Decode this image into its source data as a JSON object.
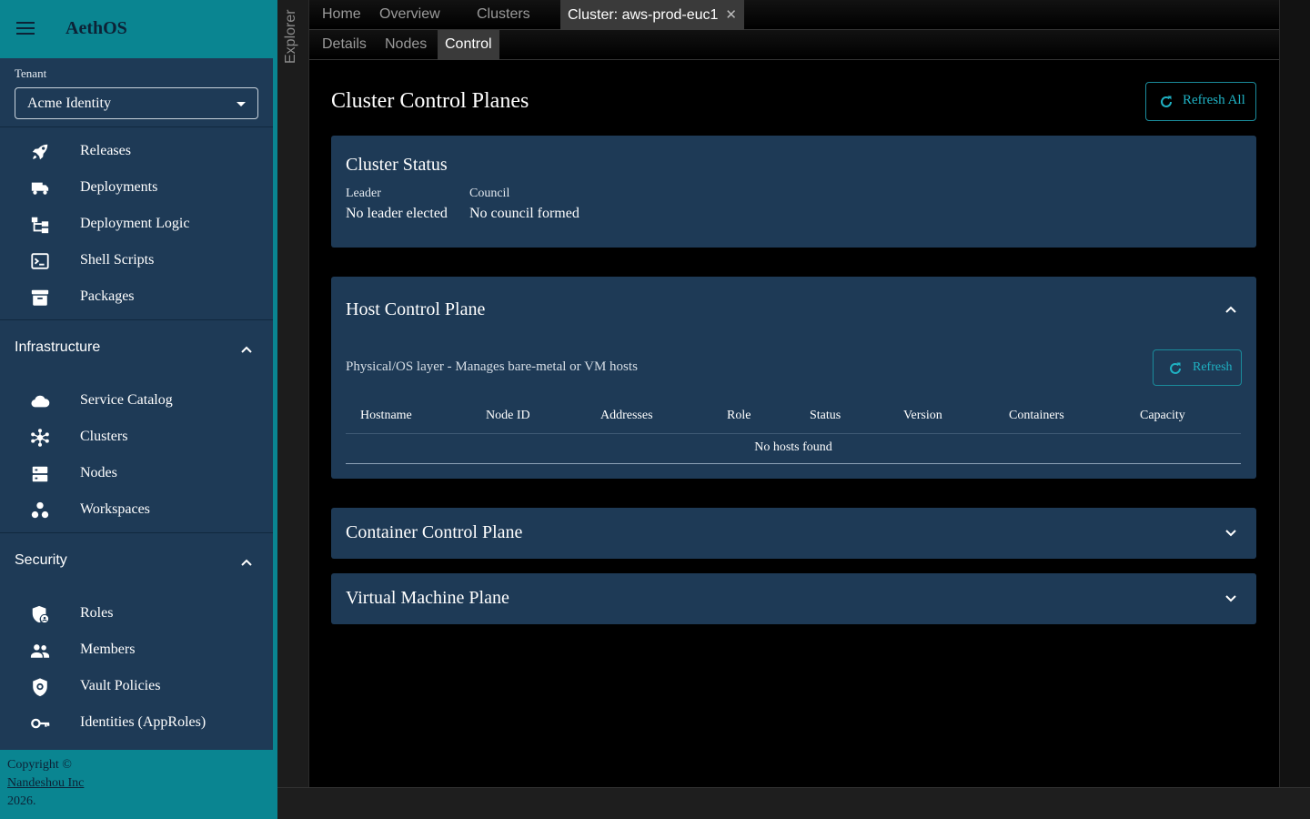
{
  "app": {
    "title": "AethOS"
  },
  "tenant": {
    "label": "Tenant",
    "value": "Acme Identity"
  },
  "nav": {
    "top_items": [
      {
        "label": "Releases",
        "icon": "rocket-icon"
      },
      {
        "label": "Deployments",
        "icon": "truck-icon"
      },
      {
        "label": "Deployment Logic",
        "icon": "flow-icon"
      },
      {
        "label": "Shell Scripts",
        "icon": "terminal-icon"
      },
      {
        "label": "Packages",
        "icon": "archive-icon"
      }
    ],
    "infrastructure": {
      "label": "Infrastructure",
      "items": [
        {
          "label": "Service Catalog",
          "icon": "cloud-icon"
        },
        {
          "label": "Clusters",
          "icon": "hub-icon"
        },
        {
          "label": "Nodes",
          "icon": "server-icon"
        },
        {
          "label": "Workspaces",
          "icon": "workspaces-icon"
        }
      ]
    },
    "security": {
      "label": "Security",
      "items": [
        {
          "label": "Roles",
          "icon": "shield-user-icon"
        },
        {
          "label": "Members",
          "icon": "people-icon"
        },
        {
          "label": "Vault Policies",
          "icon": "policy-shield-icon"
        },
        {
          "label": "Identities (AppRoles)",
          "icon": "key-icon"
        }
      ]
    }
  },
  "footer": {
    "line1": "Copyright ©",
    "company": "Nandeshou Inc",
    "year": "2026."
  },
  "explorer": {
    "label": "Explorer"
  },
  "tabs": [
    {
      "label": "Home"
    },
    {
      "label": "Overview"
    },
    {
      "label": "Clusters"
    },
    {
      "label": "Cluster: aws-prod-euc1",
      "active": true,
      "closable": true
    }
  ],
  "tab_close_glyph": "✕",
  "subtabs": [
    {
      "label": "Details"
    },
    {
      "label": "Nodes"
    },
    {
      "label": "Control",
      "active": true
    }
  ],
  "page": {
    "title": "Cluster Control Planes",
    "refresh_all": "Refresh All"
  },
  "cluster_status": {
    "title": "Cluster Status",
    "leader_label": "Leader",
    "leader_value": "No leader elected",
    "council_label": "Council",
    "council_value": "No council formed"
  },
  "host_plane": {
    "title": "Host Control Plane",
    "expanded": true,
    "description": "Physical/OS layer - Manages bare-metal or VM hosts",
    "refresh": "Refresh",
    "columns": [
      "Hostname",
      "Node ID",
      "Addresses",
      "Role",
      "Status",
      "Version",
      "Containers",
      "Capacity"
    ],
    "empty_text": "No hosts found"
  },
  "container_plane": {
    "title": "Container Control Plane",
    "expanded": false
  },
  "vm_plane": {
    "title": "Virtual Machine Plane",
    "expanded": false
  },
  "colors": {
    "sidebar_teal": "#0a8591",
    "sidebar_panel": "#1e3a56",
    "card_bg": "#1e3a56",
    "accent": "#1fb1c3",
    "page_bg": "#000000"
  }
}
